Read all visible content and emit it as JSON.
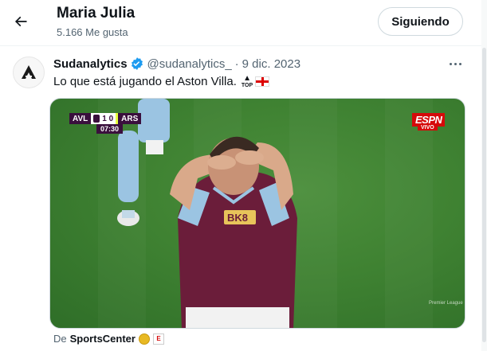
{
  "header": {
    "title": "Maria Julia",
    "subtitle": "5.166 Me gusta",
    "follow_label": "Siguiendo",
    "back_icon": "arrow-left-icon"
  },
  "tweet": {
    "author_name": "Sudanalytics",
    "handle": "@sudanalytics_",
    "separator": "·",
    "date": "9 dic. 2023",
    "text": "Lo que está jugando el Aston Villa.",
    "emoji_top_label": "TOP",
    "verified_color": "#1d9bf0",
    "more_icon": "more-horizontal-icon"
  },
  "media": {
    "team_home": "AVL",
    "score": "1 0",
    "team_away": "ARS",
    "clock": "07:30",
    "broadcaster": "ESPN",
    "live_label": "VIVO",
    "league_watermark": "Premier League"
  },
  "source": {
    "prefix": "De",
    "name": "SportsCenter"
  },
  "colors": {
    "text_primary": "#0f1419",
    "text_secondary": "#536471",
    "border": "#cfd9de",
    "villa_claret": "#6b1d3a",
    "villa_blue": "#9bc4e2",
    "pitch": "#3f8232"
  }
}
